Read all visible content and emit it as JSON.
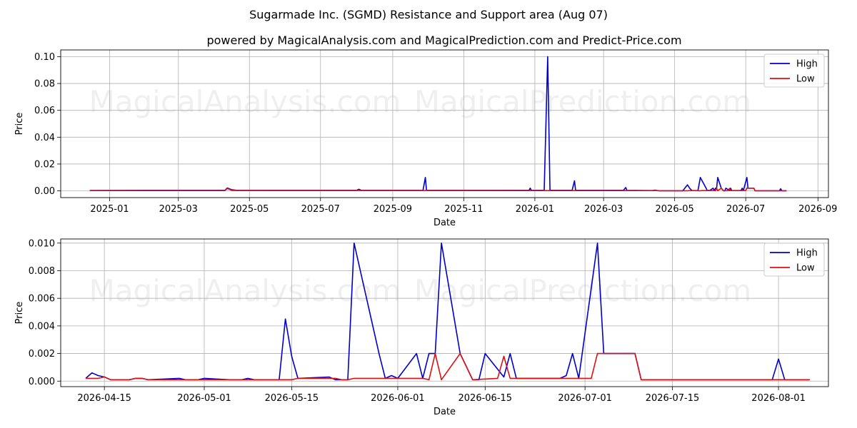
{
  "figure": {
    "title": "Sugarmade Inc. (SGMD) Resistance and Support area (Aug 07)",
    "subtitle": "powered by MagicalAnalysis.com and MagicalPrediction.com and Predict-Price.com",
    "watermarks": [
      "MagicalAnalysis.com",
      "MagicalPrediction.com"
    ]
  },
  "colors": {
    "high": "#0000cc",
    "low": "#dd1111",
    "grid": "#b0b0b0"
  },
  "chart_data": [
    {
      "type": "line",
      "xlabel": "Date",
      "ylabel": "Price",
      "xlim": [
        "2024-11-20",
        "2026-09-10"
      ],
      "ylim": [
        -0.005,
        0.105
      ],
      "grid": true,
      "legend": "top-right",
      "x_ticks": [
        {
          "date": "2025-01-01",
          "label": "2025-01"
        },
        {
          "date": "2025-03-01",
          "label": "2025-03"
        },
        {
          "date": "2025-05-01",
          "label": "2025-05"
        },
        {
          "date": "2025-07-01",
          "label": "2025-07"
        },
        {
          "date": "2025-09-01",
          "label": "2025-09"
        },
        {
          "date": "2025-11-01",
          "label": "2025-11"
        },
        {
          "date": "2026-01-01",
          "label": "2026-01"
        },
        {
          "date": "2026-03-01",
          "label": "2026-03"
        },
        {
          "date": "2026-05-01",
          "label": "2026-05"
        },
        {
          "date": "2026-07-01",
          "label": "2026-07"
        },
        {
          "date": "2026-09-01",
          "label": "2026-09"
        }
      ],
      "y_ticks": [
        {
          "value": 0.0,
          "label": "0.00"
        },
        {
          "value": 0.02,
          "label": "0.02"
        },
        {
          "value": 0.04,
          "label": "0.04"
        },
        {
          "value": 0.06,
          "label": "0.06"
        },
        {
          "value": 0.08,
          "label": "0.08"
        },
        {
          "value": 0.1,
          "label": "0.10"
        }
      ],
      "series": [
        {
          "name": "High",
          "color": "#0000cc",
          "points": [
            [
              "2024-12-15",
              0.0003
            ],
            [
              "2025-02-01",
              0.0004
            ],
            [
              "2025-04-10",
              0.0004
            ],
            [
              "2025-04-12",
              0.0022
            ],
            [
              "2025-04-16",
              0.0008
            ],
            [
              "2025-04-20",
              0.0004
            ],
            [
              "2025-08-01",
              0.0004
            ],
            [
              "2025-08-03",
              0.0012
            ],
            [
              "2025-08-05",
              0.0004
            ],
            [
              "2025-09-27",
              0.0004
            ],
            [
              "2025-09-29",
              0.01
            ],
            [
              "2025-09-30",
              0.0004
            ],
            [
              "2025-12-27",
              0.0004
            ],
            [
              "2025-12-28",
              0.002
            ],
            [
              "2025-12-29",
              0.0004
            ],
            [
              "2026-01-09",
              0.0004
            ],
            [
              "2026-01-12",
              0.1
            ],
            [
              "2026-01-14",
              0.0004
            ],
            [
              "2026-02-02",
              0.0004
            ],
            [
              "2026-02-04",
              0.0075
            ],
            [
              "2026-02-05",
              0.0004
            ],
            [
              "2026-03-18",
              0.0004
            ],
            [
              "2026-03-20",
              0.0025
            ],
            [
              "2026-03-21",
              0.0004
            ],
            [
              "2026-04-12",
              0.0002
            ],
            [
              "2026-04-14",
              0.0006
            ],
            [
              "2026-04-16",
              0.0003
            ],
            [
              "2026-04-18",
              0.0001
            ],
            [
              "2026-05-08",
              0.0001
            ],
            [
              "2026-05-12",
              0.0045
            ],
            [
              "2026-05-14",
              0.0018
            ],
            [
              "2026-05-16",
              0.0002
            ],
            [
              "2026-05-21",
              0.0002
            ],
            [
              "2026-05-23",
              0.01
            ],
            [
              "2026-05-28",
              0.002
            ],
            [
              "2026-05-29",
              0.0002
            ],
            [
              "2026-05-30",
              0.0004
            ],
            [
              "2026-05-31",
              0.0002
            ],
            [
              "2026-06-03",
              0.002
            ],
            [
              "2026-06-04",
              0.0002
            ],
            [
              "2026-06-05",
              0.002
            ],
            [
              "2026-06-06",
              0.002
            ],
            [
              "2026-06-07",
              0.01
            ],
            [
              "2026-06-10",
              0.002
            ],
            [
              "2026-06-12",
              0.0001
            ],
            [
              "2026-06-13",
              0.0001
            ],
            [
              "2026-06-14",
              0.002
            ],
            [
              "2026-06-17",
              0.0003
            ],
            [
              "2026-06-18",
              0.002
            ],
            [
              "2026-06-19",
              0.0002
            ],
            [
              "2026-06-26",
              0.0002
            ],
            [
              "2026-06-27",
              0.0004
            ],
            [
              "2026-06-28",
              0.002
            ],
            [
              "2026-06-29",
              0.0002
            ],
            [
              "2026-07-02",
              0.01
            ],
            [
              "2026-07-03",
              0.002
            ],
            [
              "2026-07-08",
              0.002
            ],
            [
              "2026-07-09",
              0.0001
            ],
            [
              "2026-07-30",
              0.0001
            ],
            [
              "2026-07-31",
              0.0016
            ],
            [
              "2026-08-01",
              0.0001
            ],
            [
              "2026-08-05",
              0.0001
            ]
          ]
        },
        {
          "name": "Low",
          "color": "#dd1111",
          "points": [
            [
              "2024-12-15",
              0.0002
            ],
            [
              "2025-04-10",
              0.0002
            ],
            [
              "2025-04-12",
              0.0018
            ],
            [
              "2025-04-16",
              0.0003
            ],
            [
              "2026-04-12",
              0.0002
            ],
            [
              "2026-04-15",
              0.0003
            ],
            [
              "2026-04-17",
              0.0001
            ],
            [
              "2026-05-12",
              0.0001
            ],
            [
              "2026-05-14",
              0.0002
            ],
            [
              "2026-05-17",
              0.0002
            ],
            [
              "2026-05-23",
              0.0001
            ],
            [
              "2026-05-24",
              0.0002
            ],
            [
              "2026-06-03",
              0.0002
            ],
            [
              "2026-06-05",
              0.0001
            ],
            [
              "2026-06-06",
              0.002
            ],
            [
              "2026-06-07",
              0.0001
            ],
            [
              "2026-06-10",
              0.002
            ],
            [
              "2026-06-12",
              0.0001
            ],
            [
              "2026-06-16",
              0.0002
            ],
            [
              "2026-06-17",
              0.0018
            ],
            [
              "2026-06-18",
              0.0002
            ],
            [
              "2026-06-24",
              0.0002
            ],
            [
              "2026-06-28",
              0.0002
            ],
            [
              "2026-07-01",
              0.0002
            ],
            [
              "2026-07-02",
              0.002
            ],
            [
              "2026-07-08",
              0.002
            ],
            [
              "2026-07-09",
              0.0001
            ],
            [
              "2026-08-05",
              0.0001
            ]
          ]
        }
      ]
    },
    {
      "type": "line",
      "xlabel": "Date",
      "ylabel": "Price",
      "xlim": [
        "2026-04-08",
        "2026-08-09"
      ],
      "ylim": [
        -0.0004,
        0.0103
      ],
      "grid": true,
      "legend": "top-right",
      "x_ticks": [
        {
          "date": "2026-04-15",
          "label": "2026-04-15"
        },
        {
          "date": "2026-05-01",
          "label": "2026-05-01"
        },
        {
          "date": "2026-05-15",
          "label": "2026-05-15"
        },
        {
          "date": "2026-06-01",
          "label": "2026-06-01"
        },
        {
          "date": "2026-06-15",
          "label": "2026-06-15"
        },
        {
          "date": "2026-07-01",
          "label": "2026-07-01"
        },
        {
          "date": "2026-07-15",
          "label": "2026-07-15"
        },
        {
          "date": "2026-08-01",
          "label": "2026-08-01"
        }
      ],
      "y_ticks": [
        {
          "value": 0.0,
          "label": "0.000"
        },
        {
          "value": 0.002,
          "label": "0.002"
        },
        {
          "value": 0.004,
          "label": "0.004"
        },
        {
          "value": 0.006,
          "label": "0.006"
        },
        {
          "value": 0.008,
          "label": "0.008"
        },
        {
          "value": 0.01,
          "label": "0.010"
        }
      ],
      "series": [
        {
          "name": "High",
          "color": "#0000cc",
          "points": [
            [
              "2026-04-12",
              0.0002
            ],
            [
              "2026-04-13",
              0.0006
            ],
            [
              "2026-04-14",
              0.0004
            ],
            [
              "2026-04-15",
              0.0003
            ],
            [
              "2026-04-16",
              0.0001
            ],
            [
              "2026-04-19",
              0.0001
            ],
            [
              "2026-04-20",
              0.0002
            ],
            [
              "2026-04-21",
              0.0002
            ],
            [
              "2026-04-22",
              0.0001
            ],
            [
              "2026-04-27",
              0.0002
            ],
            [
              "2026-04-28",
              0.0001
            ],
            [
              "2026-04-30",
              0.0001
            ],
            [
              "2026-05-01",
              0.0002
            ],
            [
              "2026-05-05",
              0.0001
            ],
            [
              "2026-05-07",
              0.0001
            ],
            [
              "2026-05-08",
              0.0002
            ],
            [
              "2026-05-09",
              0.0001
            ],
            [
              "2026-05-12",
              0.0001
            ],
            [
              "2026-05-13",
              0.0001
            ],
            [
              "2026-05-14",
              0.0045
            ],
            [
              "2026-05-15",
              0.0018
            ],
            [
              "2026-05-16",
              0.0002
            ],
            [
              "2026-05-21",
              0.0003
            ],
            [
              "2026-05-22",
              0.0001
            ],
            [
              "2026-05-24",
              0.0001
            ],
            [
              "2026-05-25",
              0.01
            ],
            [
              "2026-05-29",
              0.002
            ],
            [
              "2026-05-30",
              0.0002
            ],
            [
              "2026-05-31",
              0.0004
            ],
            [
              "2026-06-01",
              0.0002
            ],
            [
              "2026-06-04",
              0.002
            ],
            [
              "2026-06-05",
              0.0002
            ],
            [
              "2026-06-06",
              0.002
            ],
            [
              "2026-06-07",
              0.002
            ],
            [
              "2026-06-08",
              0.01
            ],
            [
              "2026-06-11",
              0.002
            ],
            [
              "2026-06-13",
              0.0001
            ],
            [
              "2026-06-14",
              0.0001
            ],
            [
              "2026-06-15",
              0.002
            ],
            [
              "2026-06-18",
              0.0003
            ],
            [
              "2026-06-19",
              0.002
            ],
            [
              "2026-06-20",
              0.0002
            ],
            [
              "2026-06-27",
              0.0002
            ],
            [
              "2026-06-28",
              0.0004
            ],
            [
              "2026-06-29",
              0.002
            ],
            [
              "2026-06-30",
              0.0002
            ],
            [
              "2026-07-03",
              0.01
            ],
            [
              "2026-07-04",
              0.002
            ],
            [
              "2026-07-09",
              0.002
            ],
            [
              "2026-07-10",
              0.0001
            ],
            [
              "2026-07-31",
              0.0001
            ],
            [
              "2026-08-01",
              0.0016
            ],
            [
              "2026-08-02",
              0.0001
            ],
            [
              "2026-08-06",
              0.0001
            ]
          ]
        },
        {
          "name": "Low",
          "color": "#dd1111",
          "points": [
            [
              "2026-04-12",
              0.0002
            ],
            [
              "2026-04-14",
              0.0002
            ],
            [
              "2026-04-15",
              0.0003
            ],
            [
              "2026-04-16",
              0.0001
            ],
            [
              "2026-04-19",
              0.0001
            ],
            [
              "2026-04-20",
              0.0002
            ],
            [
              "2026-04-21",
              0.0002
            ],
            [
              "2026-04-22",
              0.0001
            ],
            [
              "2026-05-15",
              0.0001
            ],
            [
              "2026-05-16",
              0.0002
            ],
            [
              "2026-05-22",
              0.0002
            ],
            [
              "2026-05-23",
              0.0001
            ],
            [
              "2026-05-24",
              0.0001
            ],
            [
              "2026-05-25",
              0.0002
            ],
            [
              "2026-06-05",
              0.0002
            ],
            [
              "2026-06-06",
              0.0001
            ],
            [
              "2026-06-07",
              0.002
            ],
            [
              "2026-06-08",
              0.0001
            ],
            [
              "2026-06-11",
              0.002
            ],
            [
              "2026-06-13",
              0.0001
            ],
            [
              "2026-06-17",
              0.0002
            ],
            [
              "2026-06-18",
              0.0018
            ],
            [
              "2026-06-19",
              0.0002
            ],
            [
              "2026-06-25",
              0.0002
            ],
            [
              "2026-06-29",
              0.0002
            ],
            [
              "2026-07-02",
              0.0002
            ],
            [
              "2026-07-03",
              0.002
            ],
            [
              "2026-07-09",
              0.002
            ],
            [
              "2026-07-10",
              0.0001
            ],
            [
              "2026-08-06",
              0.0001
            ]
          ]
        }
      ]
    }
  ]
}
